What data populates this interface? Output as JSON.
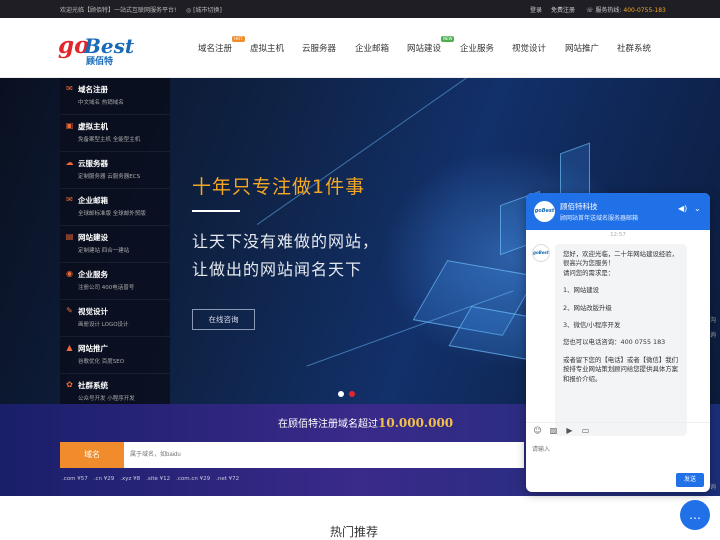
{
  "topbar": {
    "welcome": "欢迎光临【顾佰特】一站式互联网服务平台!",
    "city_switch": "[城市切换]",
    "login": "登录",
    "register": "免费注册",
    "hotline_label": "服务热线:",
    "hotline_number": "400-0755-183"
  },
  "logo": {
    "g": "go",
    "best": "Best",
    "cn": "顾佰特"
  },
  "nav": {
    "items": [
      {
        "label": "域名注册",
        "badge": "HOT"
      },
      {
        "label": "虚拟主机",
        "badge": ""
      },
      {
        "label": "云服务器",
        "badge": ""
      },
      {
        "label": "企业邮箱",
        "badge": ""
      },
      {
        "label": "网站建设",
        "badge": "NEW"
      },
      {
        "label": "企业服务",
        "badge": ""
      },
      {
        "label": "视觉设计",
        "badge": ""
      },
      {
        "label": "网站推广",
        "badge": ""
      },
      {
        "label": "社群系统",
        "badge": ""
      }
    ]
  },
  "sidebar": {
    "groups": [
      {
        "title": "域名注册",
        "subs": "中文域名    热销域名",
        "icon": "envelope-icon"
      },
      {
        "title": "虚拟主机",
        "subs": "免备案型主机    全能型主机",
        "icon": "server-icon"
      },
      {
        "title": "云服务器",
        "subs": "定制服务器    云服务器ECS",
        "icon": "cloud-icon"
      },
      {
        "title": "企业邮箱",
        "subs": "全球邮标准版    全球邮外贸版",
        "icon": "mail-icon"
      },
      {
        "title": "网站建设",
        "subs": "定制建站    四合一建站",
        "icon": "website-icon"
      },
      {
        "title": "企业服务",
        "subs": "注册公司    400电话普号",
        "icon": "eye-icon"
      },
      {
        "title": "视觉设计",
        "subs": "画册设计    LOGO设计",
        "icon": "design-icon"
      },
      {
        "title": "网站推广",
        "subs": "谷歌优化    百度SEO",
        "icon": "promote-icon"
      },
      {
        "title": "社群系统",
        "subs": "公众号开发    小程序开发",
        "icon": "community-icon"
      }
    ]
  },
  "banner": {
    "slogan_main": "十年只专注做1件事",
    "slogan_line2": "让天下没有难做的网站，",
    "slogan_line3": "让做出的网站闻名天下",
    "consult_button": "在线咨询",
    "carousel_total": 2,
    "carousel_active": 2
  },
  "domain": {
    "headline_prefix": "在顾佰特注册域名超过",
    "headline_number": "10.000.000",
    "label": "域名",
    "placeholder": "属于域名，如baidu",
    "prices": [
      ".com ¥57",
      ".cn ¥29",
      ".xyz ¥8",
      ".site ¥12",
      ".com.cn ¥29",
      ".net ¥72"
    ]
  },
  "section": {
    "hot_title": "热门推荐"
  },
  "chat": {
    "name": "顾佰特科技",
    "subtitle": "顾网站首年送域名服务器邮箱",
    "time": "12:57",
    "avatar_text": "goBest",
    "message": {
      "greeting": "您好，欢迎光临，二十年网站建设经验，很高兴为您服务！",
      "ask": "请问您的需求是：",
      "option1": "1、网站建设",
      "option2": "2、网站改版升级",
      "option3": "3、微信/小程序开发",
      "phone": "您也可以电话咨询：400 0755 183",
      "outro": "或者留下您的【电话】或者【微信】我们按排专业网站策划顾问给您提供具体方案和报价介绍。"
    },
    "input_placeholder": "请输入",
    "send_label": "发送"
  },
  "colors": {
    "accent_orange": "#f08c2b",
    "brand_blue": "#1869b6",
    "chat_blue": "#2070e8",
    "slogan_gold": "#f5a623"
  }
}
